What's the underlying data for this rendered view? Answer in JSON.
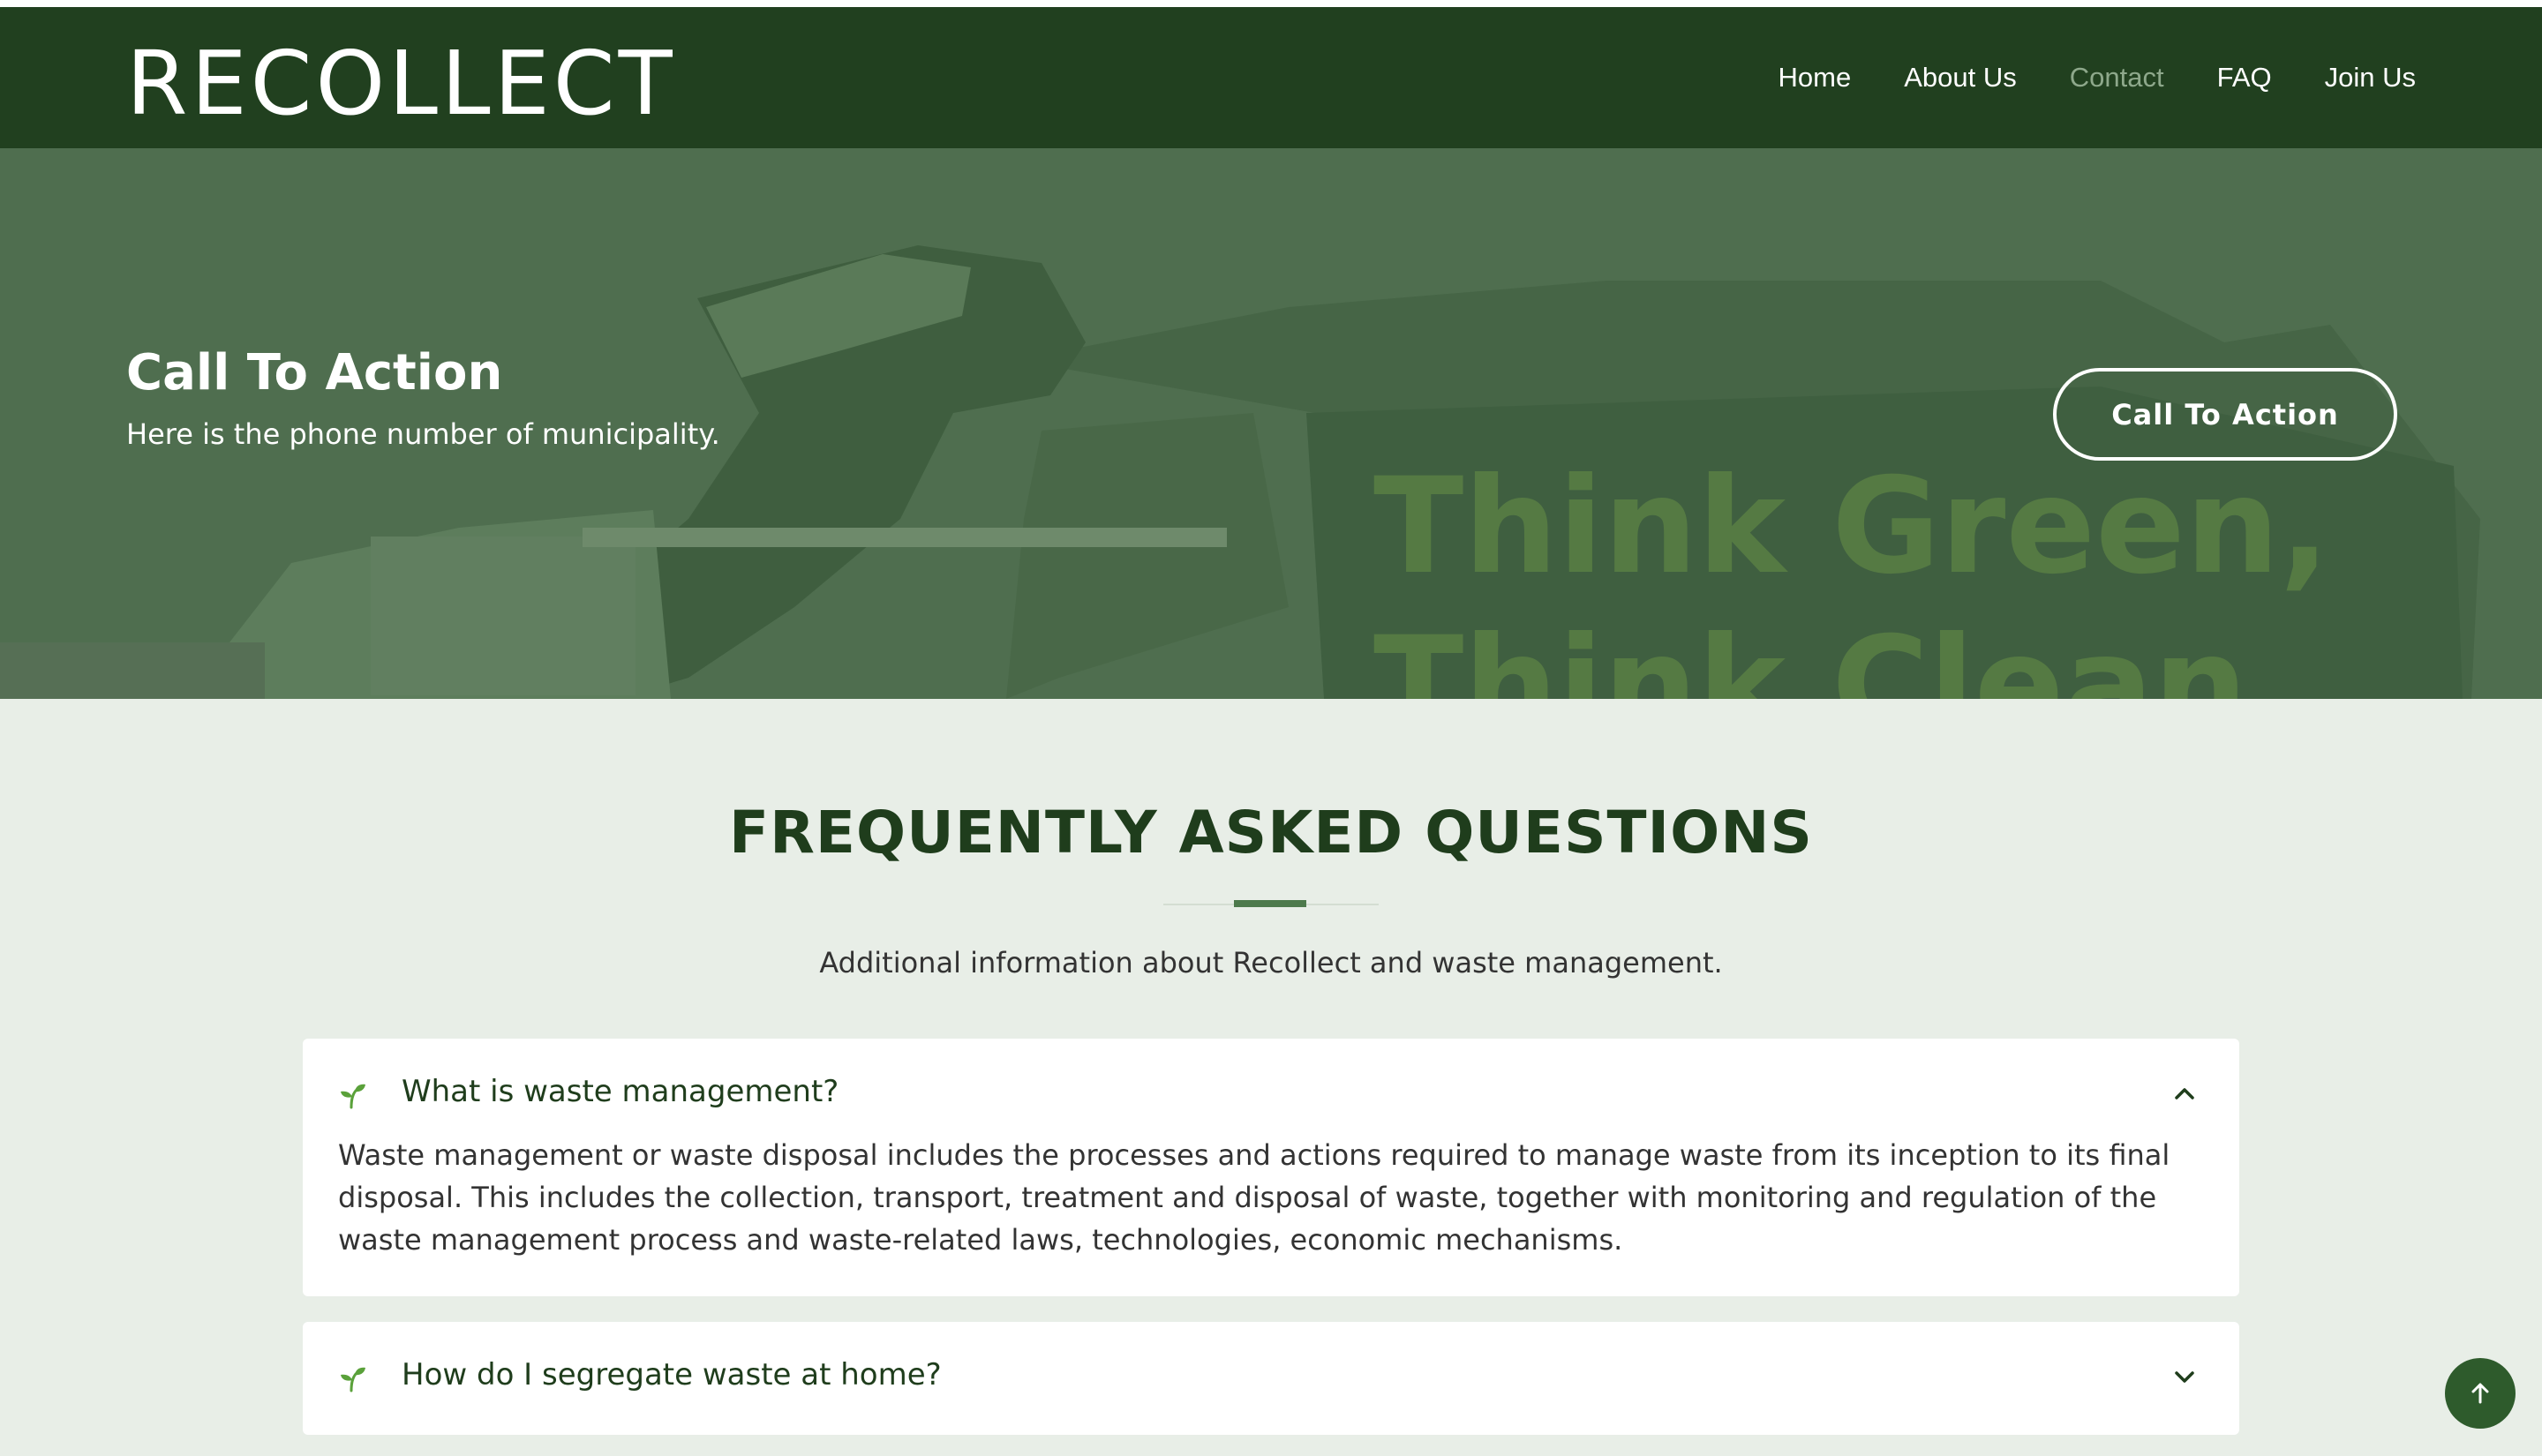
{
  "header": {
    "logo": "RECOLLECT",
    "nav": [
      {
        "label": "Home"
      },
      {
        "label": "About Us"
      },
      {
        "label": "Contact"
      },
      {
        "label": "FAQ"
      },
      {
        "label": "Join Us"
      }
    ]
  },
  "hero": {
    "title": "Call To Action",
    "subtitle": "Here is the phone number of municipality.",
    "button_label": "Call To Action",
    "background_text": [
      "Think Green,",
      "Think Clean"
    ]
  },
  "faq": {
    "title": "FREQUENTLY ASKED QUESTIONS",
    "subtitle": "Additional information about Recollect and waste management.",
    "items": [
      {
        "question": "What is waste management?",
        "answer": "Waste management or waste disposal includes the processes and actions required to manage waste from its inception to its final disposal. This includes the collection, transport, treatment and disposal of waste, together with monitoring and regulation of the waste management process and waste-related laws, technologies, economic mechanisms.",
        "expanded": true
      },
      {
        "question": "How do I segregate waste at home?",
        "expanded": false
      }
    ]
  },
  "colors": {
    "header_bg": "#21401f",
    "hero_overlay": "#4f6e4f",
    "page_bg": "#e8eee7",
    "heading": "#1f3d1c",
    "accent": "#4d7a4c",
    "sprout": "#5aa13a"
  },
  "icons": {
    "sprout": "sprout-icon",
    "expanded": "chevron-up-icon",
    "collapsed": "chevron-down-icon",
    "back_to_top": "arrow-up-icon"
  }
}
